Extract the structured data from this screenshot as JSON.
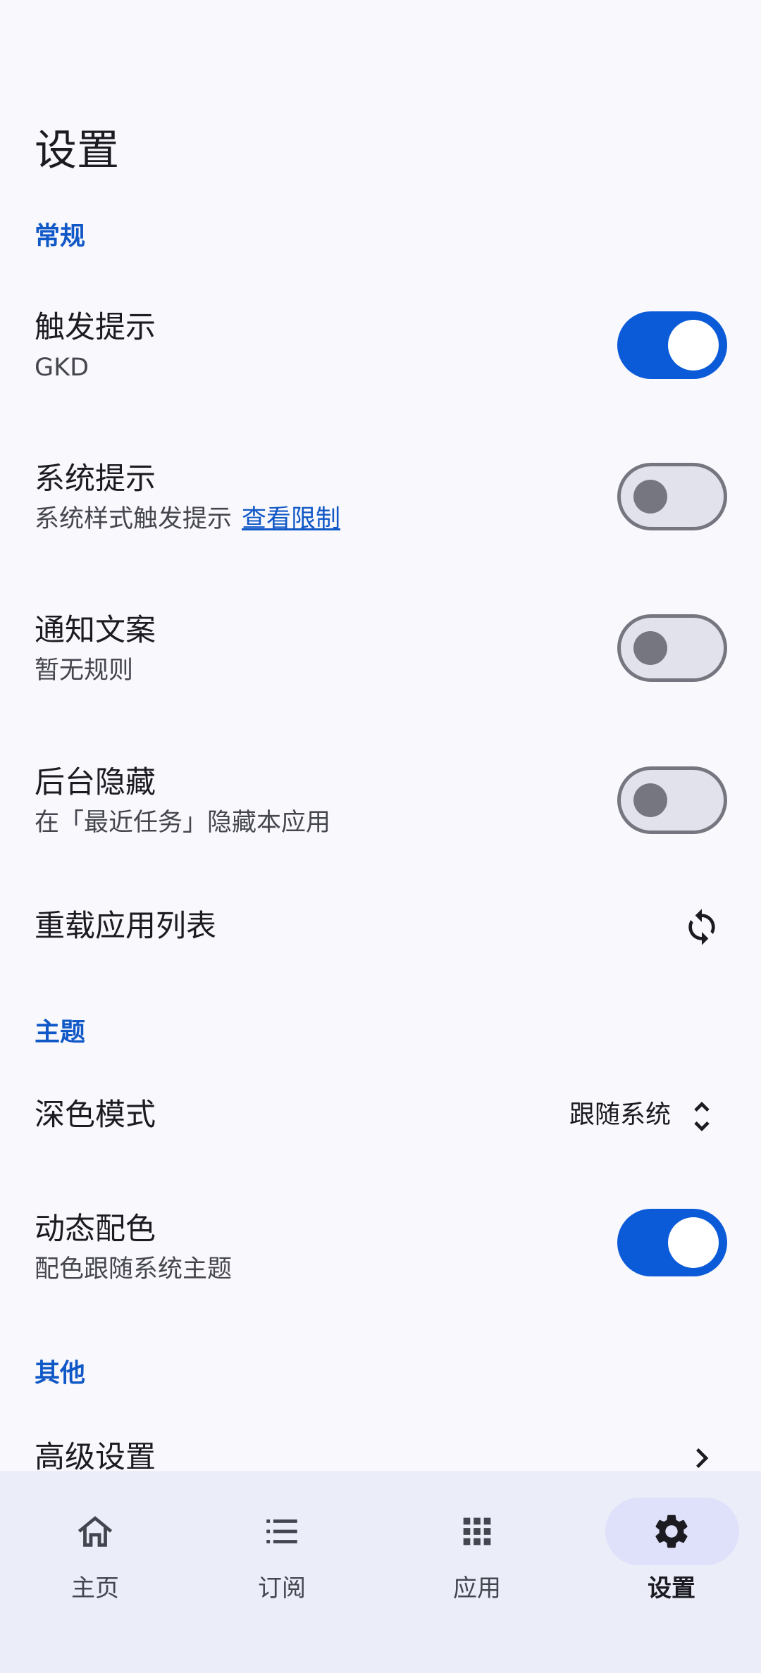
{
  "page": {
    "title": "设置"
  },
  "sections": {
    "general": "常规",
    "theme": "主题",
    "other": "其他"
  },
  "rows": {
    "trigger_tip": {
      "title": "触发提示",
      "subtitle": "GKD",
      "enabled": true
    },
    "system_tip": {
      "title": "系统提示",
      "subtitle": "系统样式触发提示",
      "link": "查看限制",
      "enabled": false
    },
    "notify_text": {
      "title": "通知文案",
      "subtitle": "暂无规则",
      "enabled": false
    },
    "hide_recent": {
      "title": "后台隐藏",
      "subtitle": "在「最近任务」隐藏本应用",
      "enabled": false
    },
    "reload_apps": {
      "title": "重载应用列表",
      "icon": "refresh-icon"
    },
    "dark_mode": {
      "title": "深色模式",
      "value": "跟随系统",
      "icon": "unfold-icon"
    },
    "dynamic_color": {
      "title": "动态配色",
      "subtitle": "配色跟随系统主题",
      "enabled": true
    },
    "advanced": {
      "title": "高级设置",
      "icon": "chevron-right-icon"
    }
  },
  "nav": {
    "items": [
      {
        "label": "主页",
        "icon": "home-icon",
        "active": false
      },
      {
        "label": "订阅",
        "icon": "list-icon",
        "active": false
      },
      {
        "label": "应用",
        "icon": "apps-grid-icon",
        "active": false
      },
      {
        "label": "设置",
        "icon": "gear-icon",
        "active": true
      }
    ]
  },
  "colors": {
    "accent": "#0b5bd8",
    "section_header": "#1158c7",
    "background": "#f8f8fd",
    "nav_background": "#ebeef9",
    "nav_active_pill": "#dfe0fa"
  }
}
